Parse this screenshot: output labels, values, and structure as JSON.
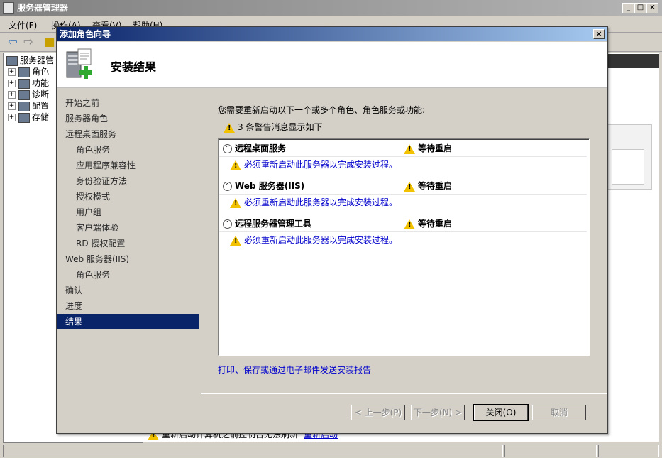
{
  "main_window": {
    "title": "服务器管理器",
    "menu": [
      "文件(F)",
      "操作(A)",
      "查看(V)",
      "帮助(H)"
    ],
    "controls": {
      "minimize": "_",
      "maximize": "□",
      "close": "×"
    }
  },
  "tree": {
    "root": "服务器管",
    "items": [
      "角色",
      "功能",
      "诊断",
      "配置",
      "存储"
    ]
  },
  "bottom_notice": {
    "text": "重新启动计算机之前控制台无法刷新",
    "link": "重新启动"
  },
  "dialog": {
    "title": "添加角色向导",
    "close": "×",
    "header_title": "安装结果",
    "nav": [
      {
        "label": "开始之前",
        "level": 0
      },
      {
        "label": "服务器角色",
        "level": 0
      },
      {
        "label": "远程桌面服务",
        "level": 0
      },
      {
        "label": "角色服务",
        "level": 1
      },
      {
        "label": "应用程序兼容性",
        "level": 1
      },
      {
        "label": "身份验证方法",
        "level": 1
      },
      {
        "label": "授权模式",
        "level": 1
      },
      {
        "label": "用户组",
        "level": 1
      },
      {
        "label": "客户端体验",
        "level": 1
      },
      {
        "label": "RD 授权配置",
        "level": 1
      },
      {
        "label": "Web 服务器(IIS)",
        "level": 0
      },
      {
        "label": "角色服务",
        "level": 1
      },
      {
        "label": "确认",
        "level": 0
      },
      {
        "label": "进度",
        "level": 0
      },
      {
        "label": "结果",
        "level": 0,
        "active": true
      }
    ],
    "intro": "您需要重新启动以下一个或多个角色、角色服务或功能:",
    "warning_summary": "3 条警告消息显示如下",
    "results": [
      {
        "role": "远程桌面服务",
        "status": "等待重启",
        "message": "必须重新启动此服务器以完成安装过程。"
      },
      {
        "role": "Web 服务器(IIS)",
        "status": "等待重启",
        "message": "必须重新启动此服务器以完成安装过程。"
      },
      {
        "role": "远程服务器管理工具",
        "status": "等待重启",
        "message": "必须重新启动此服务器以完成安装过程。"
      }
    ],
    "report_link": "打印、保存或通过电子邮件发送安装报告",
    "buttons": {
      "prev": "< 上一步(P)",
      "next": "下一步(N) >",
      "close": "关闭(O)",
      "cancel": "取消"
    }
  }
}
